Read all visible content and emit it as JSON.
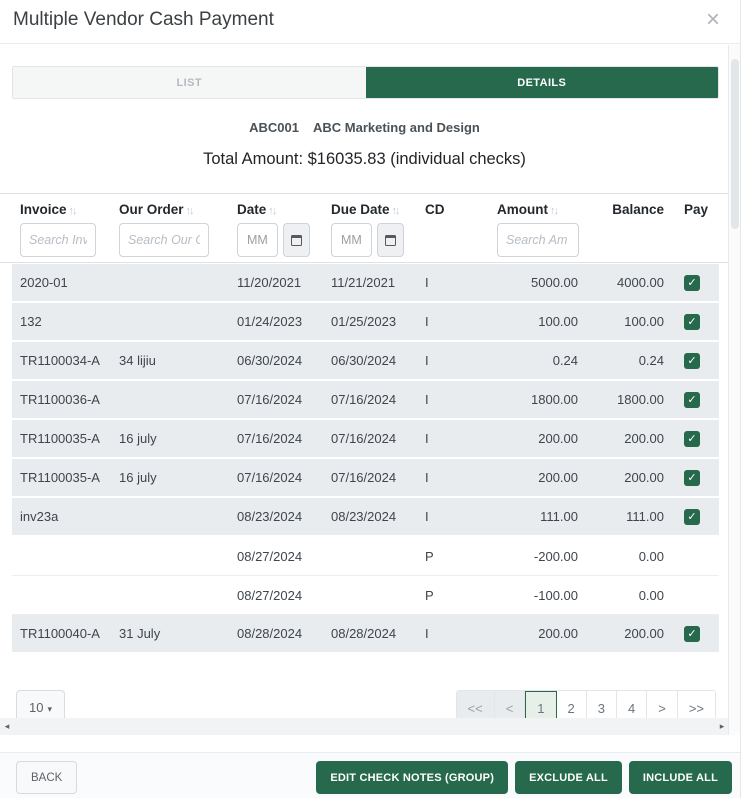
{
  "modal": {
    "title": "Multiple Vendor Cash Payment",
    "close_icon": "×"
  },
  "tabs": {
    "list": "LIST",
    "details": "DETAILS",
    "active_tab": "DETAILS"
  },
  "vendor": {
    "code": "ABC001",
    "name": "ABC Marketing and Design"
  },
  "summary": {
    "total_line": "Total Amount: $16035.83 (individual checks)"
  },
  "table": {
    "headers": {
      "invoice": "Invoice",
      "our_order": "Our Order",
      "date": "Date",
      "due_date": "Due Date",
      "cd": "CD",
      "amount": "Amount",
      "balance": "Balance",
      "pay": "Pay"
    },
    "sort_icon": "↑↓",
    "search": {
      "invoice_placeholder": "Search Inv",
      "our_order_placeholder": "Search Our Or",
      "date_placeholder": "MM/",
      "due_date_placeholder": "MM/",
      "amount_placeholder": "Search Am"
    },
    "rows": [
      {
        "invoice": "2020-01",
        "our_order": "",
        "date": "11/20/2021",
        "due_date": "11/21/2021",
        "cd": "I",
        "amount": "5000.00",
        "balance": "4000.00",
        "pay": true
      },
      {
        "invoice": "132",
        "our_order": "",
        "date": "01/24/2023",
        "due_date": "01/25/2023",
        "cd": "I",
        "amount": "100.00",
        "balance": "100.00",
        "pay": true
      },
      {
        "invoice": "TR1100034-A",
        "our_order": "34 lijiu",
        "date": "06/30/2024",
        "due_date": "06/30/2024",
        "cd": "I",
        "amount": "0.24",
        "balance": "0.24",
        "pay": true
      },
      {
        "invoice": "TR1100036-A",
        "our_order": "",
        "date": "07/16/2024",
        "due_date": "07/16/2024",
        "cd": "I",
        "amount": "1800.00",
        "balance": "1800.00",
        "pay": true
      },
      {
        "invoice": "TR1100035-A",
        "our_order": "16 july",
        "date": "07/16/2024",
        "due_date": "07/16/2024",
        "cd": "I",
        "amount": "200.00",
        "balance": "200.00",
        "pay": true
      },
      {
        "invoice": "TR1100035-A",
        "our_order": "16 july",
        "date": "07/16/2024",
        "due_date": "07/16/2024",
        "cd": "I",
        "amount": "200.00",
        "balance": "200.00",
        "pay": true
      },
      {
        "invoice": "inv23a",
        "our_order": "",
        "date": "08/23/2024",
        "due_date": "08/23/2024",
        "cd": "I",
        "amount": "111.00",
        "balance": "111.00",
        "pay": true
      },
      {
        "invoice": "",
        "our_order": "",
        "date": "08/27/2024",
        "due_date": "",
        "cd": "P",
        "amount": "-200.00",
        "balance": "0.00",
        "pay": false
      },
      {
        "invoice": "",
        "our_order": "",
        "date": "08/27/2024",
        "due_date": "",
        "cd": "P",
        "amount": "-100.00",
        "balance": "0.00",
        "pay": false
      },
      {
        "invoice": "TR1100040-A",
        "our_order": "31 July",
        "date": "08/28/2024",
        "due_date": "08/28/2024",
        "cd": "I",
        "amount": "200.00",
        "balance": "200.00",
        "pay": true
      }
    ],
    "checkmark": "✓"
  },
  "pagination": {
    "page_size": "10",
    "caret": "▾",
    "buttons": [
      {
        "label": "<<",
        "state": "disabled"
      },
      {
        "label": "<",
        "state": "disabled"
      },
      {
        "label": "1",
        "state": "active"
      },
      {
        "label": "2",
        "state": "normal"
      },
      {
        "label": "3",
        "state": "normal"
      },
      {
        "label": "4",
        "state": "normal"
      },
      {
        "label": ">",
        "state": "normal"
      },
      {
        "label": ">>",
        "state": "normal"
      }
    ]
  },
  "scrollbar": {
    "left_arrow": "◂",
    "right_arrow": "▸"
  },
  "footer": {
    "back": "BACK",
    "edit_check_notes": "EDIT CHECK NOTES (GROUP)",
    "exclude_all": "EXCLUDE ALL",
    "include_all": "INCLUDE ALL"
  },
  "colors": {
    "accent_green": "#26694D",
    "row_gray": "#e9ecef",
    "active_page_bg": "#e7efe9"
  }
}
